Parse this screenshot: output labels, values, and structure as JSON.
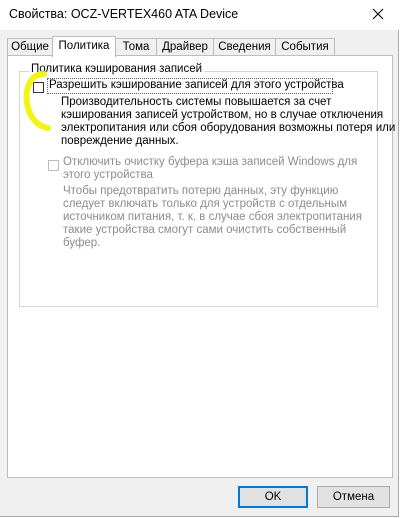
{
  "window": {
    "title": "Свойства: OCZ-VERTEX460 ATA Device"
  },
  "tabs": [
    {
      "label": "Общие"
    },
    {
      "label": "Политика"
    },
    {
      "label": "Тома"
    },
    {
      "label": "Драйвер"
    },
    {
      "label": "Сведения"
    },
    {
      "label": "События"
    }
  ],
  "active_tab": "Политика",
  "group": {
    "title": "Политика кэширования записей",
    "write_cache": {
      "label": "Разрешить кэширование записей для этого устройства",
      "checked": false,
      "description": [
        "Производительность системы повышается за счет",
        "кэширования записей устройством, но в случае отключения",
        "электропитания или сбоя оборудования возможны потеря или",
        "повреждение данных."
      ]
    },
    "flush_off": {
      "label": [
        "Отключить очистку буфера кэша записей Windows для",
        "этого устройства"
      ],
      "checked": false,
      "enabled": false,
      "description": [
        "Чтобы предотвратить потерю данных, эту функцию",
        "следует включать только для устройств с отдельным",
        "источником питания, т. к. в случае сбоя электропитания",
        "такие устройства смогут сами очистить собственный",
        "буфер."
      ]
    }
  },
  "buttons": {
    "ok": "OK",
    "cancel": "Отмена"
  },
  "colors": {
    "highlight": "#f2f200",
    "accent": "#0078d7"
  }
}
